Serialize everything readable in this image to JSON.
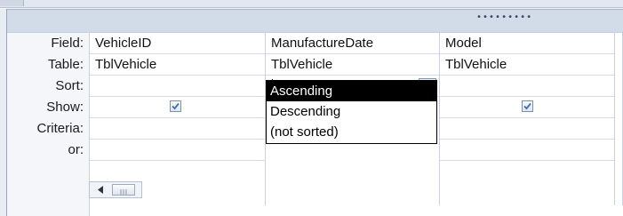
{
  "grid": {
    "row_labels": [
      "Field:",
      "Table:",
      "Sort:",
      "Show:",
      "Criteria:",
      "or:"
    ],
    "columns": [
      {
        "field": "VehicleID",
        "table": "TblVehicle",
        "sort": "",
        "show": true
      },
      {
        "field": "ManufactureDate",
        "table": "TblVehicle",
        "sort": "",
        "show": false
      },
      {
        "field": "Model",
        "table": "TblVehicle",
        "sort": "",
        "show": true
      }
    ]
  },
  "sort_dropdown": {
    "options": [
      "Ascending",
      "Descending",
      "(not sorted)"
    ],
    "highlighted": "Ascending"
  },
  "splitter": {
    "grip": "•••••••••"
  },
  "icons": {
    "dropdown": "chevron-down-icon",
    "checkbox": "checkmark-icon",
    "scroll_left": "triangle-left-icon",
    "scroll_thumb": "grip-lines-icon"
  }
}
